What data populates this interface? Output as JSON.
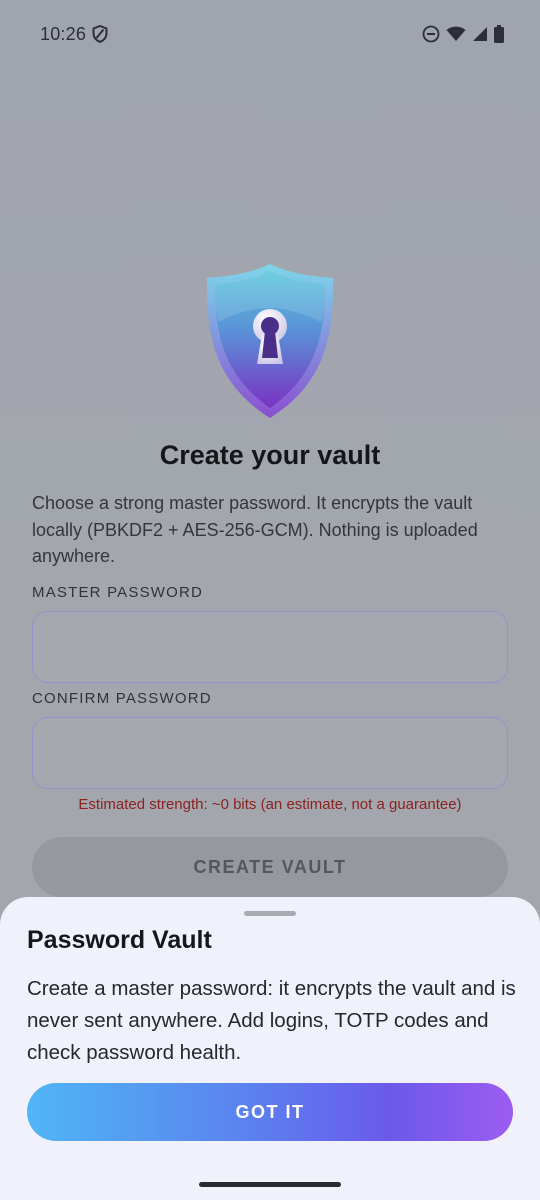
{
  "status_bar": {
    "time": "10:26",
    "icons": [
      "shield-icon",
      "do-not-disturb-icon",
      "wifi-icon",
      "signal-icon",
      "battery-icon"
    ]
  },
  "vault_setup": {
    "logo_icon": "shield-keyhole-icon",
    "title": "Create your vault",
    "description": "Choose a strong master password. It encrypts the vault locally (PBKDF2 + AES-256-GCM). Nothing is uploaded anywhere.",
    "master_password_label": "MASTER PASSWORD",
    "master_password_value": "",
    "confirm_password_label": "CONFIRM PASSWORD",
    "confirm_password_value": "",
    "strength_text": "Estimated strength: ~0 bits (an estimate, not a guarantee)",
    "create_button_label": "CREATE VAULT"
  },
  "bottom_sheet": {
    "title": "Password Vault",
    "body": "Create a master password: it encrypts the vault and is never sent anywhere. Add logins, TOTP codes and check password health.",
    "got_it_label": "GOT IT"
  },
  "colors": {
    "scrim": "#a3a6ae",
    "sheet_background": "#f0f1fb",
    "strength_error": "#8b2222",
    "accent_gradient_start": "#4fb6f5",
    "accent_gradient_end": "#9c5cf0"
  }
}
